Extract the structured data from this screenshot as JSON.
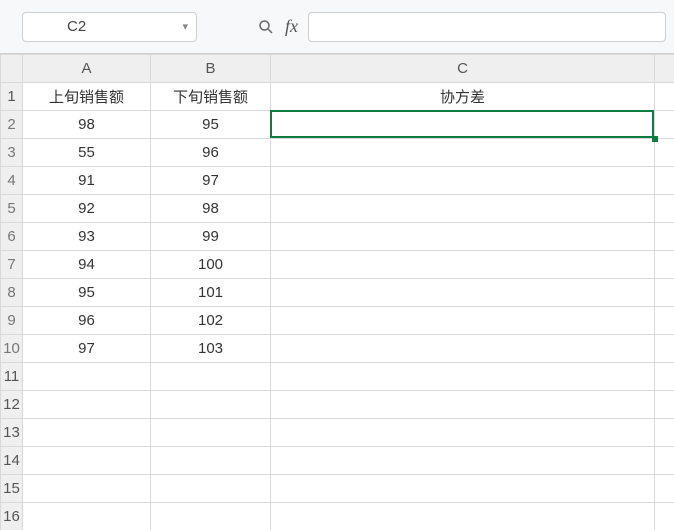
{
  "formula_bar": {
    "name_box_value": "C2",
    "fx_label": "fx",
    "formula_value": ""
  },
  "columns": {
    "A": "A",
    "B": "B",
    "C": "C",
    "D": ""
  },
  "rows_visible": [
    "1",
    "2",
    "3",
    "4",
    "5",
    "6",
    "7",
    "8",
    "9",
    "10",
    "11",
    "12",
    "13",
    "14",
    "15",
    "16"
  ],
  "headers": {
    "A1": "上旬销售额",
    "B1": "下旬销售额",
    "C1": "协方差"
  },
  "chart_data": {
    "type": "table",
    "columns": [
      "上旬销售额",
      "下旬销售额"
    ],
    "rows": [
      [
        98,
        95
      ],
      [
        55,
        96
      ],
      [
        91,
        97
      ],
      [
        92,
        98
      ],
      [
        93,
        99
      ],
      [
        94,
        100
      ],
      [
        95,
        101
      ],
      [
        96,
        102
      ],
      [
        97,
        103
      ]
    ]
  },
  "cells": {
    "A2": "98",
    "B2": "95",
    "A3": "55",
    "B3": "96",
    "A4": "91",
    "B4": "97",
    "A5": "92",
    "B5": "98",
    "A6": "93",
    "B6": "99",
    "A7": "94",
    "B7": "100",
    "A8": "95",
    "B8": "101",
    "A9": "96",
    "B9": "102",
    "A10": "97",
    "B10": "103"
  },
  "selection": {
    "cell": "C2"
  }
}
